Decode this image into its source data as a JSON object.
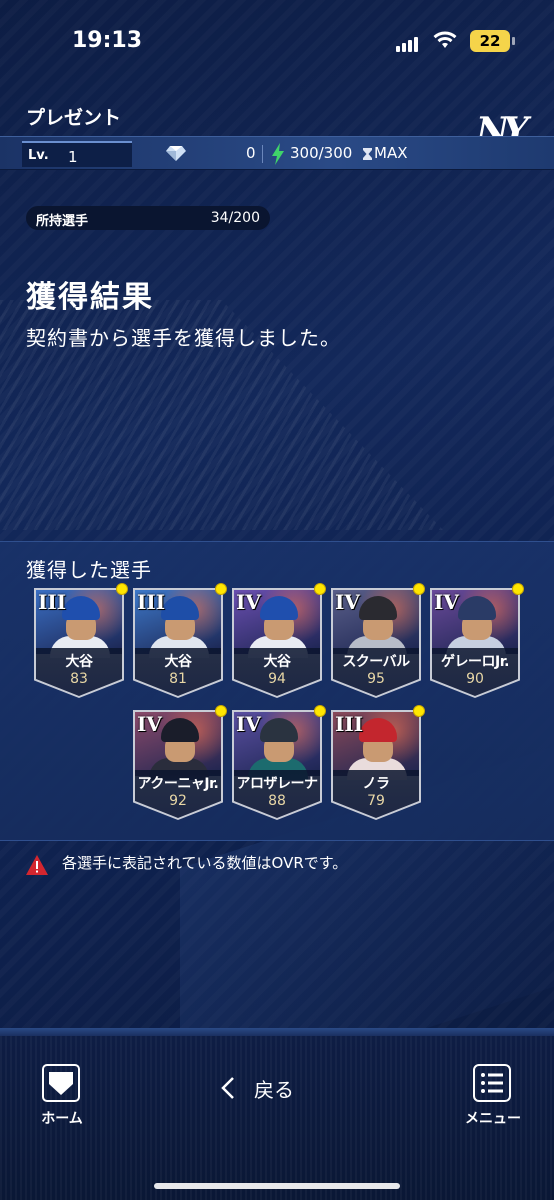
{
  "status": {
    "time": "19:13",
    "battery": "22"
  },
  "header": {
    "title": "プレゼント",
    "team_logo": "NY"
  },
  "infobar": {
    "lv_label": "Lv.",
    "lv_value": "1",
    "gems": "0",
    "stamina": "300/300",
    "max": "MAX"
  },
  "owned": {
    "label": "所持選手",
    "value": "34/200"
  },
  "result": {
    "title": "獲得結果",
    "subtitle": "契約書から選手を獲得しました。"
  },
  "acquired": {
    "title": "獲得した選手",
    "players": [
      {
        "name": "大谷",
        "ovr": "83",
        "rank": "III",
        "bg": "#3a6fc4",
        "cap": "#1f4fae",
        "jersey": "#e9ecf3"
      },
      {
        "name": "大谷",
        "ovr": "81",
        "rank": "III",
        "bg": "#3d78c9",
        "cap": "#1e4ea8",
        "jersey": "#dfe5ef"
      },
      {
        "name": "大谷",
        "ovr": "94",
        "rank": "IV",
        "bg": "#6a4fb0",
        "cap": "#1f4fae",
        "jersey": "#e9ecf3"
      },
      {
        "name": "スクーバル",
        "ovr": "95",
        "rank": "IV",
        "bg": "#5a5f8a",
        "cap": "#2a2a30",
        "jersey": "#b7bcc8"
      },
      {
        "name": "ゲレーロJr.",
        "ovr": "90",
        "rank": "IV",
        "bg": "#6a4a9a",
        "cap": "#2a3b66",
        "jersey": "#c6cfe0"
      },
      {
        "name": "アクーニャJr.",
        "ovr": "92",
        "rank": "IV",
        "bg": "#8a4a6a",
        "cap": "#1a1d2a",
        "jersey": "#2a2d3c"
      },
      {
        "name": "アロザレーナ",
        "ovr": "88",
        "rank": "IV",
        "bg": "#5a4fa0",
        "cap": "#2a3340",
        "jersey": "#1c6b6e"
      },
      {
        "name": "ノラ",
        "ovr": "79",
        "rank": "III",
        "bg": "#8a4a5a",
        "cap": "#c3262e",
        "jersey": "#e9dcdc"
      }
    ]
  },
  "notice": {
    "text": "各選手に表記されている数値はOVRです。"
  },
  "nav": {
    "home": "ホーム",
    "back": "戻る",
    "menu": "メニュー"
  },
  "colors": {
    "accent_yellow": "#ffe600",
    "warning_red": "#d4262f",
    "stamina_green": "#3fd36a"
  }
}
